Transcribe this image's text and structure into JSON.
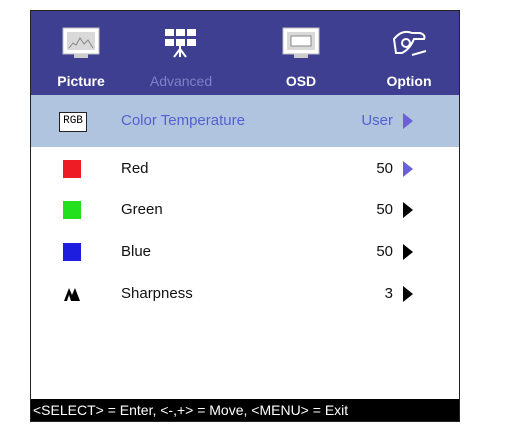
{
  "tabs": [
    {
      "label": "Picture",
      "icon": "picture-icon"
    },
    {
      "label": "Advanced",
      "icon": "advanced-icon"
    },
    {
      "label": "OSD",
      "icon": "osd-icon"
    },
    {
      "label": "Option",
      "icon": "option-icon"
    }
  ],
  "active_tab": "Advanced",
  "rows": [
    {
      "icon_text": "RGB",
      "label": "Color Temperature",
      "value": "User"
    },
    {
      "label": "Red",
      "value": "50",
      "color": "#ee1c24"
    },
    {
      "label": "Green",
      "value": "50",
      "color": "#22e01e"
    },
    {
      "label": "Blue",
      "value": "50",
      "color": "#1d1ddf"
    },
    {
      "label": "Sharpness",
      "value": "3",
      "icon": "sharpness-icon"
    }
  ],
  "footer": "<SELECT> = Enter, <-,+> = Move, <MENU> = Exit",
  "colors": {
    "header_bg": "#3f3f91",
    "selected_bg": "#b0c4df",
    "highlight_text": "#5560d0"
  }
}
